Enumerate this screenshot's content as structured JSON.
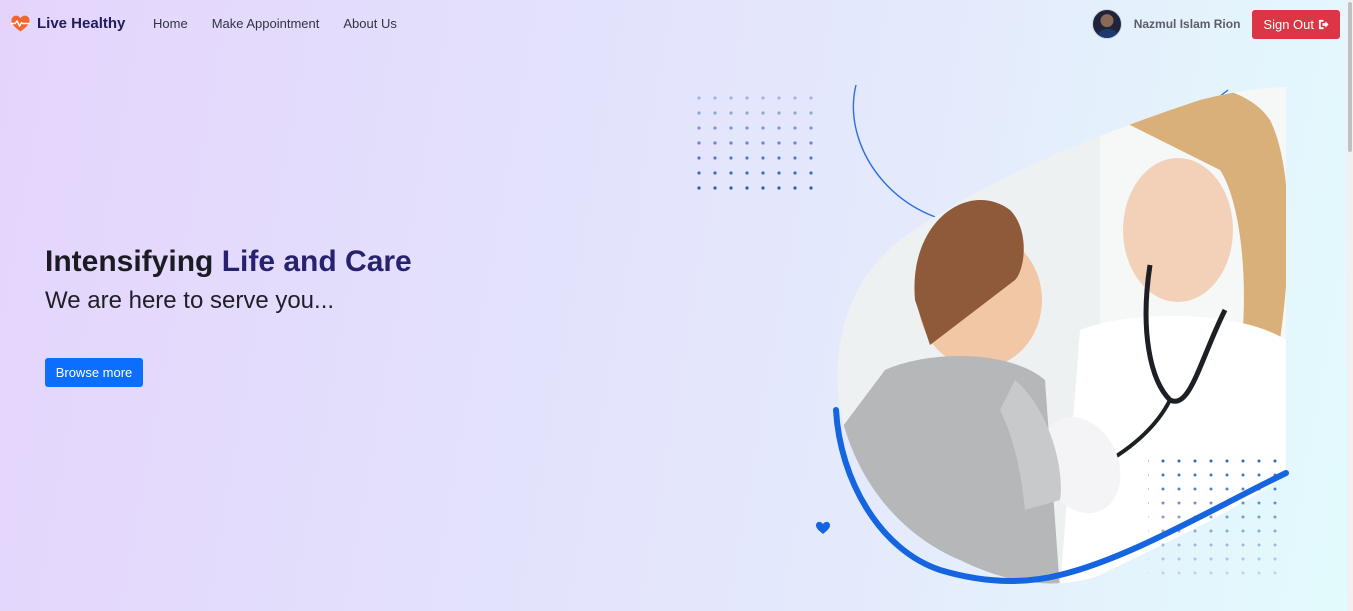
{
  "brand": {
    "name": "Live Healthy",
    "icon": "heart-pulse-icon"
  },
  "nav": {
    "links": [
      {
        "label": "Home"
      },
      {
        "label": "Make Appointment"
      },
      {
        "label": "About Us"
      }
    ]
  },
  "user": {
    "name": "Nazmul Islam Rion",
    "avatar": "user-avatar",
    "signout_label": "Sign Out",
    "signout_icon": "sign-out-icon"
  },
  "hero": {
    "title_part1": "Intensifying ",
    "title_part2": "Life and Care",
    "subtitle": "We are here to serve you...",
    "button_label": "Browse more",
    "image": "doctor-examining-child-illustration"
  },
  "colors": {
    "brand_text": "#1f1d5c",
    "accent_title": "#27226e",
    "primary_button": "#0d6efd",
    "danger_button": "#dc3545",
    "art_blue": "#1565e0"
  }
}
